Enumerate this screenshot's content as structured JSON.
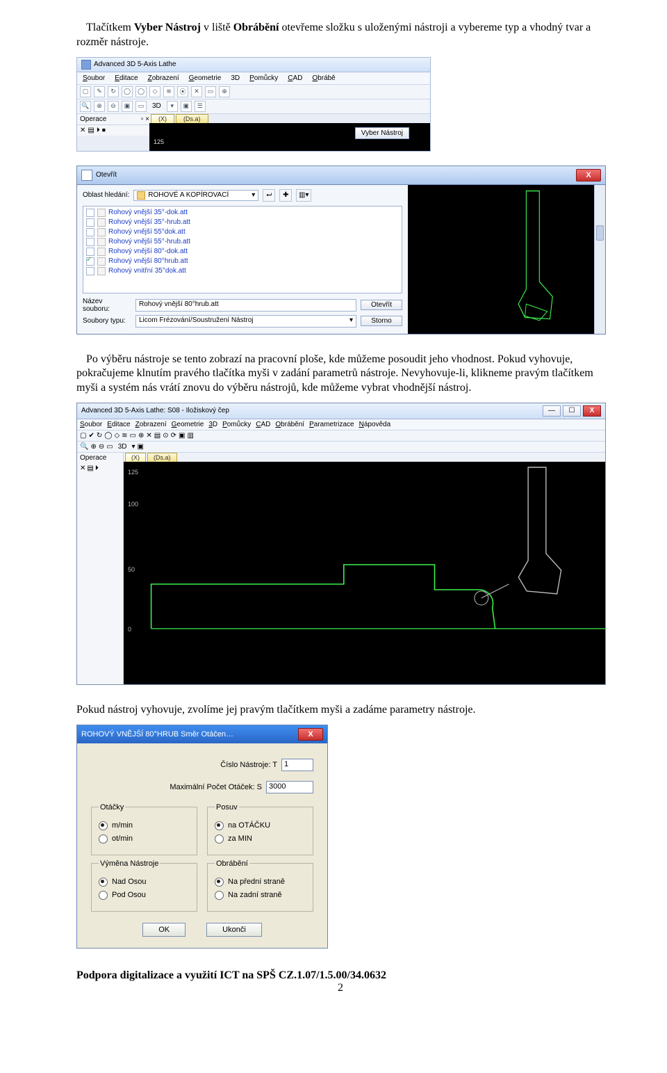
{
  "text": {
    "p1_a": "Tlačítkem ",
    "p1_b": "Vyber Nástroj",
    "p1_c": " v liště ",
    "p1_d": "Obrábění",
    "p1_e": " otevřeme složku s uloženými nástroji a vybereme typ a vhodný tvar a rozměr nástroje.",
    "p2": "Po výběru nástroje se tento zobrazí na pracovní ploše, kde můžeme posoudit jeho vhodnost. Pokud vyhovuje, pokračujeme klnutím pravého tlačítka myši v zadání parametrů nástroje. Nevyhovuje-li, klikneme pravým tlačítkem myši a systém nás vrátí znovu do výběru nástrojů, kde můžeme vybrat vhodnější nástroj.",
    "p3": "Pokud nástroj vyhovuje, zvolíme jej pravým tlačítkem myši a zadáme parametry nástroje.",
    "footer": "Podpora digitalizace a využití ICT na SPŠ  CZ.1.07/1.5.00/34.0632",
    "pageNumber": "2"
  },
  "shot1": {
    "title": "Advanced 3D 5-Axis Lathe",
    "menu": [
      "Soubor",
      "Editace",
      "Zobrazení",
      "Geometrie",
      "3D",
      "Pomůcky",
      "CAD",
      "Obrábě"
    ],
    "opsLabel": "Operace",
    "threeD": "3D",
    "axisX": "(X)",
    "axisD": "(Ds.a)",
    "axisVal": "125",
    "button": "Vyber Nástroj"
  },
  "shot2": {
    "title": "Otevřít",
    "lookIn": "Oblast hledání:",
    "folder": "ROHOVÉ A KOPÍROVACÍ",
    "files": [
      "Rohový vnější 35°-dok.att",
      "Rohový vnější 35°-hrub.att",
      "Rohový vnější 55°dok.att",
      "Rohový vnější 55°-hrub.att",
      "Rohový vnější 80°-dok.att",
      "Rohový vnější 80°hrub.att",
      "Rohový vnitřní 35°dok.att"
    ],
    "checkedIndex": 5,
    "nameLabel": "Název souboru:",
    "nameValue": "Rohový vnější 80°hrub.att",
    "typeLabel": "Soubory typu:",
    "typeValue": "Licom Frézování/Soustružení Nástroj",
    "openBtn": "Otevřít",
    "cancelBtn": "Storno"
  },
  "shot3": {
    "title": "Advanced 3D 5-Axis Lathe: S08 - Iložiskový čep",
    "menu": [
      "Soubor",
      "Editace",
      "Zobrazení",
      "Geometrie",
      "3D",
      "Pomůcky",
      "CAD",
      "Obrábění",
      "Parametrizace",
      "Nápověda"
    ],
    "opsLabel": "Operace",
    "threeD": "3D",
    "yLabels": [
      "125",
      "100",
      "50",
      "0"
    ],
    "tabX": "(X)",
    "tabD": "(Ds.a)"
  },
  "shot4": {
    "title": "ROHOVÝ VNĚJŠÍ 80°HRUB  Směr Otáčen…",
    "toolNoLabel": "Číslo Nástroje: T",
    "toolNoValue": "1",
    "rpmLabel": "Maximální Počet Otáček: S",
    "rpmValue": "3000",
    "groups": {
      "otacky": {
        "legend": "Otáčky",
        "opts": [
          "m/min",
          "ot/min"
        ],
        "sel": 0
      },
      "posuv": {
        "legend": "Posuv",
        "opts": [
          "na OTÁČKU",
          "za MIN"
        ],
        "sel": 0
      },
      "vymena": {
        "legend": "Výměna Nástroje",
        "opts": [
          "Nad Osou",
          "Pod Osou"
        ],
        "sel": 0
      },
      "obrabeni": {
        "legend": "Obrábění",
        "opts": [
          "Na přední straně",
          "Na zadní straně"
        ],
        "sel": 0
      }
    },
    "ok": "OK",
    "cancel": "Ukonči"
  }
}
